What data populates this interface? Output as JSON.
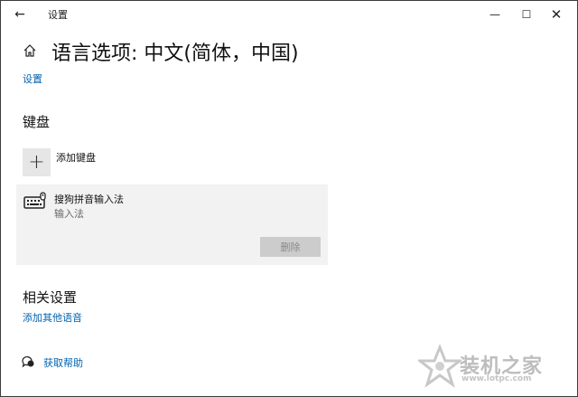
{
  "window": {
    "title": "设置",
    "back_glyph": "←",
    "minimize_glyph": "—",
    "maximize_glyph": "☐",
    "close_glyph": "✕"
  },
  "header": {
    "title": "语言选项: 中文(简体，中国)",
    "breadcrumb_link": "设置"
  },
  "keyboard_section": {
    "heading": "键盘",
    "add_label": "添加键盘",
    "add_glyph": "+",
    "items": [
      {
        "name": "搜狗拼音输入法",
        "subtitle": "输入法",
        "delete_label": "删除"
      }
    ]
  },
  "related_section": {
    "heading": "相关设置",
    "link": "添加其他语音"
  },
  "help": {
    "label": "获取帮助"
  },
  "watermark": {
    "brand": "装机之家",
    "url": "www.lotpc.com"
  },
  "colors": {
    "link": "#0063b1",
    "tile": "#e6e6e6",
    "card": "#f2f2f2",
    "disabled_button": "#cccccc"
  },
  "icons": [
    "back-arrow-icon",
    "home-icon",
    "keyboard-icon",
    "help-chat-icon"
  ]
}
